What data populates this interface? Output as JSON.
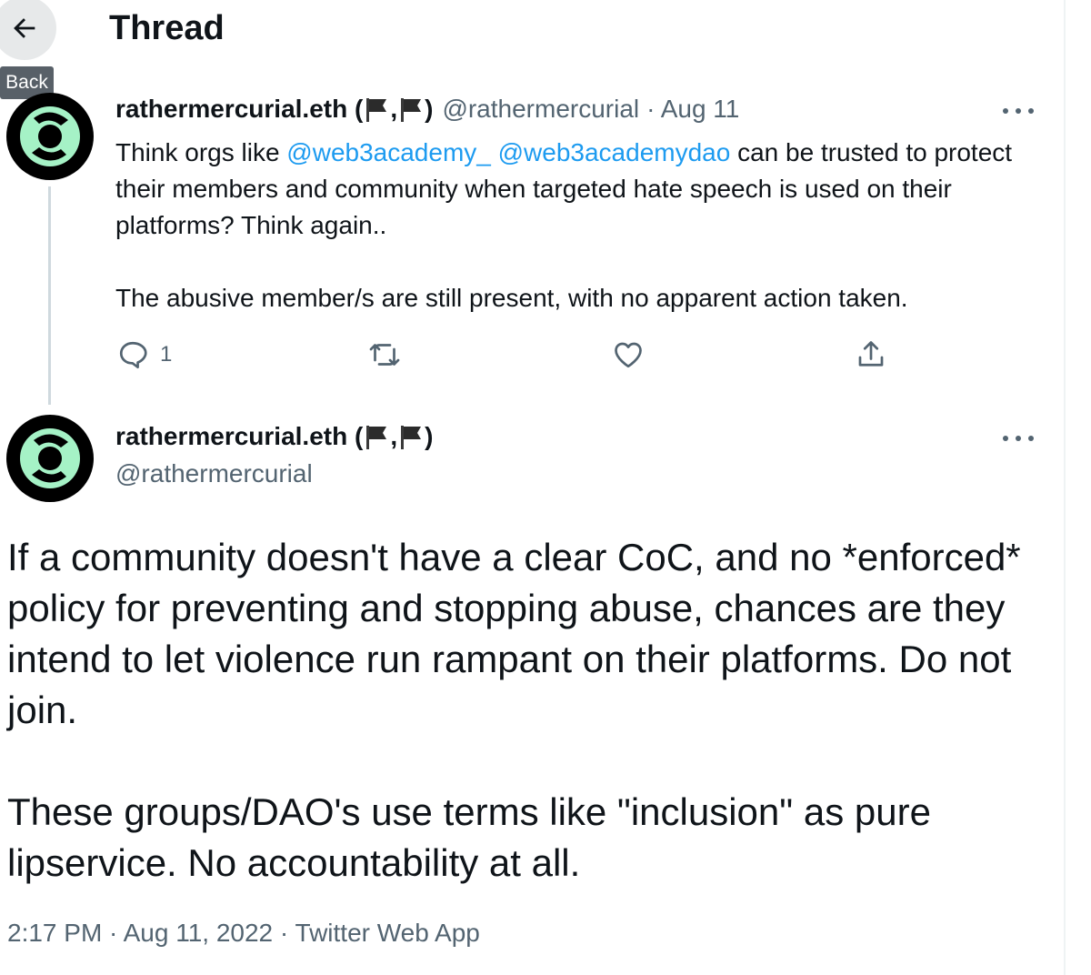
{
  "header": {
    "title": "Thread",
    "back_tooltip": "Back"
  },
  "tweet1": {
    "display_name": "rathermercurial.eth (",
    "flag_separator": ",",
    "name_close": ")",
    "handle": "@rathermercurial",
    "date": "· Aug 11",
    "text_before": "Think orgs like ",
    "mention1": "@web3academy_",
    "mention2": "@web3academydao",
    "text_after": " can be trusted to protect their members and community when targeted hate speech is used on their platforms? Think again..",
    "text_p2": "The abusive member/s are still present, with no apparent action taken.",
    "reply_count": "1"
  },
  "tweet2": {
    "display_name": "rathermercurial.eth (",
    "flag_separator": ",",
    "name_close": ")",
    "handle": "@rathermercurial",
    "text_p1": "If a community doesn't have a clear CoC, and no *enforced* policy for preventing and stopping abuse, chances are they intend to let violence run rampant on their platforms. Do not join.",
    "text_p2": "These groups/DAO's use terms like \"inclusion\" as pure lipservice. No accountability at all.",
    "meta": "2:17 PM · Aug 11, 2022 · Twitter Web App"
  },
  "icons": [
    "back-arrow-icon",
    "more-icon",
    "reply-icon",
    "retweet-icon",
    "like-icon",
    "share-icon",
    "flag-icon"
  ],
  "colors": {
    "link": "#1d9bf0",
    "secondary": "#536471",
    "text": "#0f1419",
    "avatar_ring": "#a5f2c6"
  }
}
